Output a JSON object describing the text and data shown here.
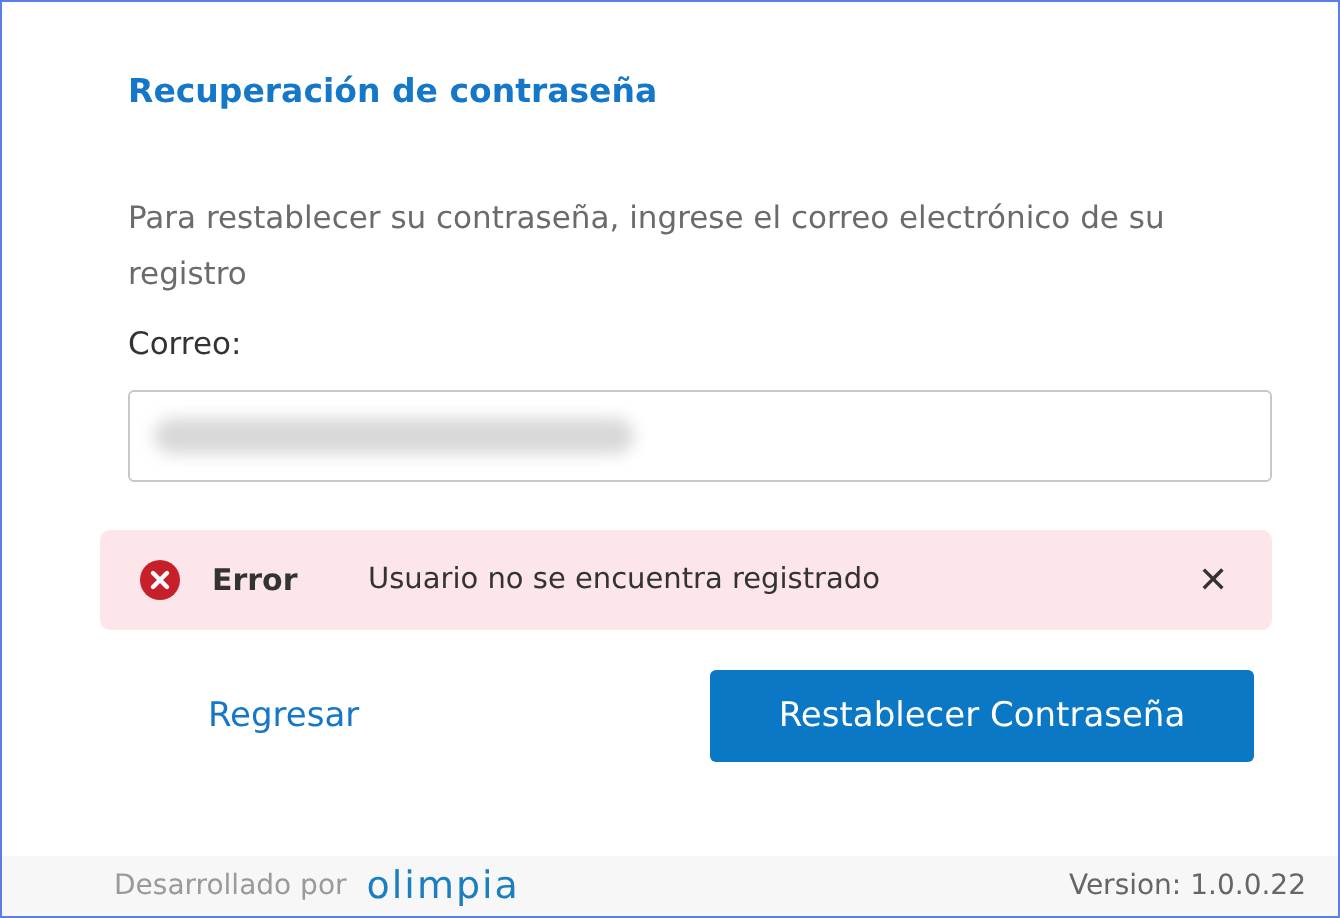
{
  "dialog": {
    "title": "Recuperación de contraseña",
    "instructions": "Para restablecer su contraseña, ingrese el correo electrónico de su registro",
    "email_field": {
      "label": "Correo:",
      "value_redacted": true
    },
    "alert": {
      "kind": "error",
      "title": "Error",
      "message": "Usuario no se encuentra registrado",
      "dismiss": "✕"
    },
    "buttons": [
      {
        "kind": "link",
        "label": "Regresar"
      },
      {
        "kind": "primary",
        "label": "Restablecer Contraseña"
      }
    ]
  },
  "footer": {
    "credit": "Desarrollado por",
    "logo": "olimpia",
    "version": "Version: 1.0.0.22"
  }
}
